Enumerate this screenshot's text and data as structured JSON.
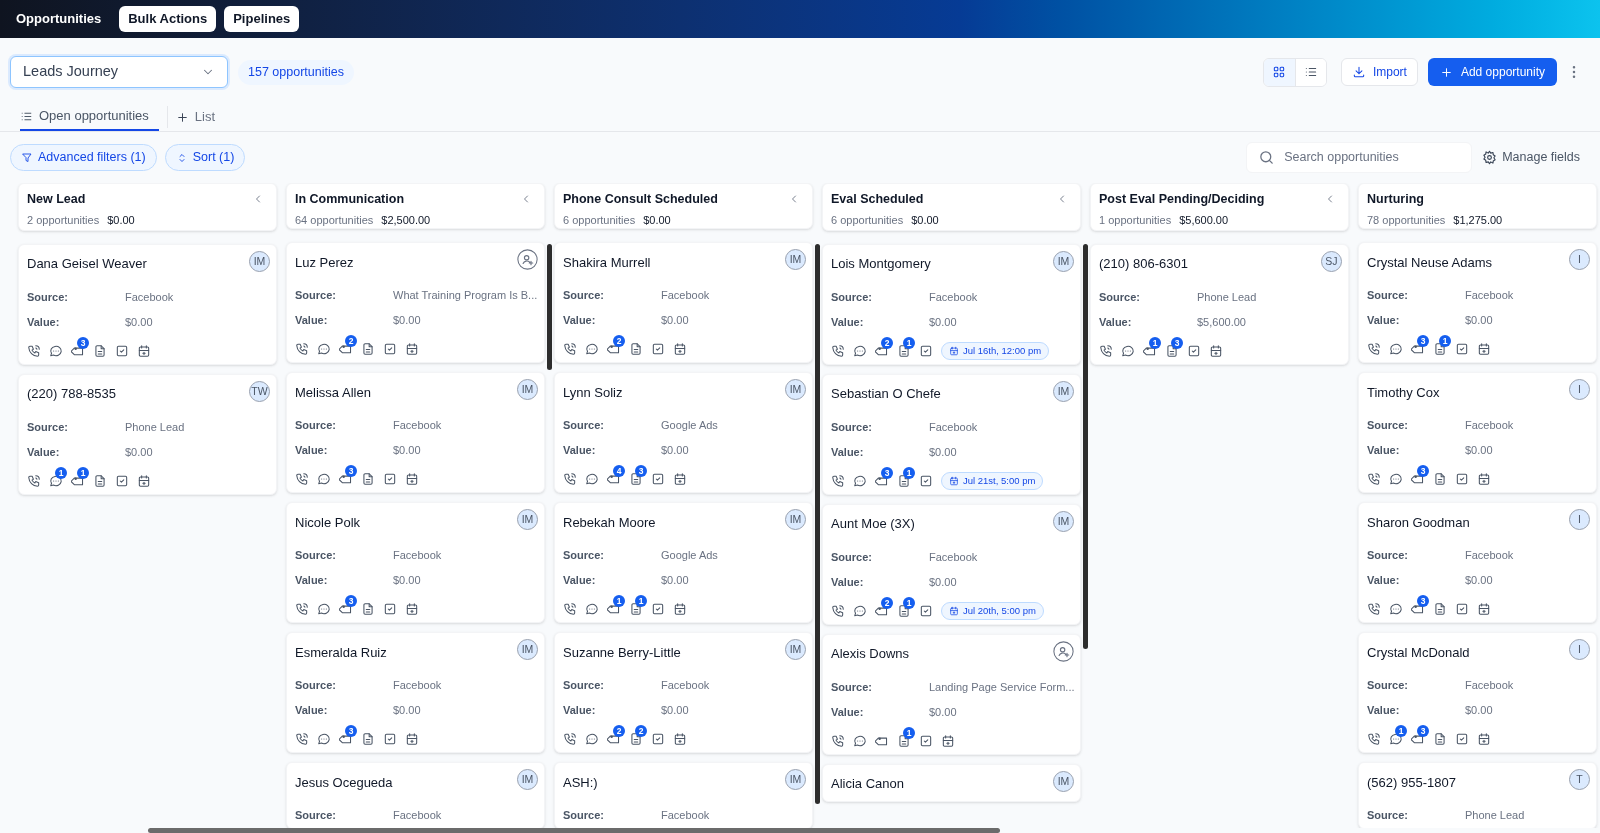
{
  "top_nav": [
    {
      "label": "Opportunities",
      "selected": true
    },
    {
      "label": "Bulk Actions",
      "selected": false
    },
    {
      "label": "Pipelines",
      "selected": false
    }
  ],
  "pipeline_select": {
    "value": "Leads Journey"
  },
  "opportunity_count": "157 opportunities",
  "view_toggle": [
    {
      "kind": "grid",
      "selected": true
    },
    {
      "kind": "list",
      "selected": false
    }
  ],
  "import_button": "Import",
  "add_button": "Add opportunity",
  "tabs": [
    {
      "label": "Open opportunities",
      "selected": true
    }
  ],
  "add_list_button": "List",
  "filters": [
    {
      "kind": "filter",
      "label": "Advanced filters (1)"
    },
    {
      "kind": "sort",
      "label": "Sort (1)"
    }
  ],
  "search": {
    "placeholder": "Search opportunities"
  },
  "manage_fields": "Manage fields",
  "columns": [
    {
      "title": "New Lead",
      "count": "2 opportunities",
      "amount": "$0.00",
      "collapsible": true,
      "cards": [
        {
          "name": "Dana Geisel Weaver",
          "assignee": "IM",
          "fields": [
            {
              "label": "Source:",
              "value": "Facebook"
            },
            {
              "label": "Value:",
              "value": "$0.00"
            }
          ],
          "actions": [
            {
              "kind": "call"
            },
            {
              "kind": "message"
            },
            {
              "kind": "tag",
              "count": "3"
            },
            {
              "kind": "note"
            },
            {
              "kind": "task"
            },
            {
              "kind": "calendar"
            }
          ]
        },
        {
          "name": "(220) 788-8535",
          "assignee": "TW",
          "fields": [
            {
              "label": "Source:",
              "value": "Phone Lead"
            },
            {
              "label": "Value:",
              "value": "$0.00"
            }
          ],
          "actions": [
            {
              "kind": "call"
            },
            {
              "kind": "message",
              "count": "1"
            },
            {
              "kind": "tag",
              "count": "1"
            },
            {
              "kind": "note"
            },
            {
              "kind": "task"
            },
            {
              "kind": "calendar"
            }
          ]
        }
      ]
    },
    {
      "title": "In Communication",
      "count": "64 opportunities",
      "amount": "$2,500.00",
      "collapsible": true,
      "cards": [
        {
          "name": "Luz Perez",
          "fields": [
            {
              "label": "Source:",
              "value": "What Training Program Is B..."
            },
            {
              "label": "Value:",
              "value": "$0.00"
            }
          ],
          "actions": [
            {
              "kind": "call"
            },
            {
              "kind": "message"
            },
            {
              "kind": "tag",
              "count": "2"
            },
            {
              "kind": "note"
            },
            {
              "kind": "task"
            },
            {
              "kind": "calendar"
            }
          ]
        },
        {
          "name": "Melissa Allen",
          "assignee": "IM",
          "fields": [
            {
              "label": "Source:",
              "value": "Facebook"
            },
            {
              "label": "Value:",
              "value": "$0.00"
            }
          ],
          "actions": [
            {
              "kind": "call"
            },
            {
              "kind": "message"
            },
            {
              "kind": "tag",
              "count": "3"
            },
            {
              "kind": "note"
            },
            {
              "kind": "task"
            },
            {
              "kind": "calendar"
            }
          ]
        },
        {
          "name": "Nicole Polk",
          "assignee": "IM",
          "fields": [
            {
              "label": "Source:",
              "value": "Facebook"
            },
            {
              "label": "Value:",
              "value": "$0.00"
            }
          ],
          "actions": [
            {
              "kind": "call"
            },
            {
              "kind": "message"
            },
            {
              "kind": "tag",
              "count": "3"
            },
            {
              "kind": "note"
            },
            {
              "kind": "task"
            },
            {
              "kind": "calendar"
            }
          ]
        },
        {
          "name": "Esmeralda Ruiz",
          "assignee": "IM",
          "fields": [
            {
              "label": "Source:",
              "value": "Facebook"
            },
            {
              "label": "Value:",
              "value": "$0.00"
            }
          ],
          "actions": [
            {
              "kind": "call"
            },
            {
              "kind": "message"
            },
            {
              "kind": "tag",
              "count": "3"
            },
            {
              "kind": "note"
            },
            {
              "kind": "task"
            },
            {
              "kind": "calendar"
            }
          ]
        },
        {
          "name": "Jesus Ocegueda",
          "assignee": "IM",
          "fields": [
            {
              "label": "Source:",
              "value": "Facebook"
            }
          ]
        }
      ]
    },
    {
      "title": "Phone Consult Scheduled",
      "count": "6 opportunities",
      "amount": "$0.00",
      "collapsible": true,
      "cards": [
        {
          "name": "Shakira Murrell",
          "assignee": "IM",
          "fields": [
            {
              "label": "Source:",
              "value": "Facebook"
            },
            {
              "label": "Value:",
              "value": "$0.00"
            }
          ],
          "actions": [
            {
              "kind": "call"
            },
            {
              "kind": "message"
            },
            {
              "kind": "tag",
              "count": "2"
            },
            {
              "kind": "note"
            },
            {
              "kind": "task"
            },
            {
              "kind": "calendar"
            }
          ]
        },
        {
          "name": "Lynn Soliz",
          "assignee": "IM",
          "fields": [
            {
              "label": "Source:",
              "value": "Google Ads"
            },
            {
              "label": "Value:",
              "value": "$0.00"
            }
          ],
          "actions": [
            {
              "kind": "call"
            },
            {
              "kind": "message"
            },
            {
              "kind": "tag",
              "count": "4"
            },
            {
              "kind": "note",
              "count": "3"
            },
            {
              "kind": "task"
            },
            {
              "kind": "calendar"
            }
          ]
        },
        {
          "name": "Rebekah Moore",
          "assignee": "IM",
          "fields": [
            {
              "label": "Source:",
              "value": "Google Ads"
            },
            {
              "label": "Value:",
              "value": "$0.00"
            }
          ],
          "actions": [
            {
              "kind": "call"
            },
            {
              "kind": "message"
            },
            {
              "kind": "tag",
              "count": "1"
            },
            {
              "kind": "note",
              "count": "1"
            },
            {
              "kind": "task"
            },
            {
              "kind": "calendar"
            }
          ]
        },
        {
          "name": "Suzanne Berry-Little",
          "assignee": "IM",
          "fields": [
            {
              "label": "Source:",
              "value": "Facebook"
            },
            {
              "label": "Value:",
              "value": "$0.00"
            }
          ],
          "actions": [
            {
              "kind": "call"
            },
            {
              "kind": "message"
            },
            {
              "kind": "tag",
              "count": "2"
            },
            {
              "kind": "note",
              "count": "2"
            },
            {
              "kind": "task"
            },
            {
              "kind": "calendar"
            }
          ]
        },
        {
          "name": "ASH:)",
          "assignee": "IM",
          "fields": [
            {
              "label": "Source:",
              "value": "Facebook"
            }
          ]
        }
      ]
    },
    {
      "title": "Eval Scheduled",
      "count": "6 opportunities",
      "amount": "$0.00",
      "collapsible": true,
      "cards": [
        {
          "name": "Lois Montgomery",
          "assignee": "IM",
          "fields": [
            {
              "label": "Source:",
              "value": "Facebook"
            },
            {
              "label": "Value:",
              "value": "$0.00"
            }
          ],
          "actions": [
            {
              "kind": "call"
            },
            {
              "kind": "message"
            },
            {
              "kind": "tag",
              "count": "2"
            },
            {
              "kind": "note",
              "count": "1"
            },
            {
              "kind": "task"
            },
            {
              "kind": "appointment",
              "label": "Jul 16th, 12:00 pm"
            }
          ]
        },
        {
          "name": "Sebastian O Chefe",
          "assignee": "IM",
          "fields": [
            {
              "label": "Source:",
              "value": "Facebook"
            },
            {
              "label": "Value:",
              "value": "$0.00"
            }
          ],
          "actions": [
            {
              "kind": "call"
            },
            {
              "kind": "message"
            },
            {
              "kind": "tag",
              "count": "3"
            },
            {
              "kind": "note",
              "count": "1"
            },
            {
              "kind": "task"
            },
            {
              "kind": "appointment",
              "label": "Jul 21st, 5:00 pm"
            }
          ]
        },
        {
          "name": "Aunt Moe (3X)",
          "assignee": "IM",
          "fields": [
            {
              "label": "Source:",
              "value": "Facebook"
            },
            {
              "label": "Value:",
              "value": "$0.00"
            }
          ],
          "actions": [
            {
              "kind": "call"
            },
            {
              "kind": "message"
            },
            {
              "kind": "tag",
              "count": "2"
            },
            {
              "kind": "note",
              "count": "1"
            },
            {
              "kind": "task"
            },
            {
              "kind": "appointment",
              "label": "Jul 20th, 5:00 pm"
            }
          ]
        },
        {
          "name": "Alexis Downs",
          "fields": [
            {
              "label": "Source:",
              "value": "Landing Page Service Form..."
            },
            {
              "label": "Value:",
              "value": "$0.00"
            }
          ],
          "actions": [
            {
              "kind": "call"
            },
            {
              "kind": "message"
            },
            {
              "kind": "tag"
            },
            {
              "kind": "note",
              "count": "1"
            },
            {
              "kind": "task"
            },
            {
              "kind": "calendar"
            }
          ]
        },
        {
          "name": "Alicia Canon",
          "assignee": "IM"
        }
      ]
    },
    {
      "title": "Post Eval Pending/Deciding",
      "count": "1 opportunities",
      "amount": "$5,600.00",
      "collapsible": true,
      "cards": [
        {
          "name": "(210) 806-6301",
          "assignee": "SJ",
          "fields": [
            {
              "label": "Source:",
              "value": "Phone Lead"
            },
            {
              "label": "Value:",
              "value": "$5,600.00"
            }
          ],
          "actions": [
            {
              "kind": "call"
            },
            {
              "kind": "message"
            },
            {
              "kind": "tag",
              "count": "1"
            },
            {
              "kind": "note",
              "count": "3"
            },
            {
              "kind": "task"
            },
            {
              "kind": "calendar"
            }
          ]
        }
      ]
    },
    {
      "title": "Nurturing",
      "count": "78 opportunities",
      "amount": "$1,275.00",
      "collapsible": false,
      "cards": [
        {
          "name": "Crystal Neuse Adams",
          "assignee": "I",
          "fields": [
            {
              "label": "Source:",
              "value": "Facebook"
            },
            {
              "label": "Value:",
              "value": "$0.00"
            }
          ],
          "actions": [
            {
              "kind": "call"
            },
            {
              "kind": "message"
            },
            {
              "kind": "tag",
              "count": "3"
            },
            {
              "kind": "note",
              "count": "1"
            },
            {
              "kind": "task"
            },
            {
              "kind": "calendar"
            }
          ]
        },
        {
          "name": "Timothy Cox",
          "assignee": "I",
          "fields": [
            {
              "label": "Source:",
              "value": "Facebook"
            },
            {
              "label": "Value:",
              "value": "$0.00"
            }
          ],
          "actions": [
            {
              "kind": "call"
            },
            {
              "kind": "message"
            },
            {
              "kind": "tag",
              "count": "3"
            },
            {
              "kind": "note"
            },
            {
              "kind": "task"
            },
            {
              "kind": "calendar"
            }
          ]
        },
        {
          "name": "Sharon Goodman",
          "assignee": "I",
          "fields": [
            {
              "label": "Source:",
              "value": "Facebook"
            },
            {
              "label": "Value:",
              "value": "$0.00"
            }
          ],
          "actions": [
            {
              "kind": "call"
            },
            {
              "kind": "message"
            },
            {
              "kind": "tag",
              "count": "3"
            },
            {
              "kind": "note"
            },
            {
              "kind": "task"
            },
            {
              "kind": "calendar"
            }
          ]
        },
        {
          "name": "Crystal McDonald",
          "assignee": "I",
          "fields": [
            {
              "label": "Source:",
              "value": "Facebook"
            },
            {
              "label": "Value:",
              "value": "$0.00"
            }
          ],
          "actions": [
            {
              "kind": "call"
            },
            {
              "kind": "message",
              "count": "1"
            },
            {
              "kind": "tag",
              "count": "3"
            },
            {
              "kind": "note"
            },
            {
              "kind": "task"
            },
            {
              "kind": "calendar"
            }
          ]
        },
        {
          "name": "(562) 955-1807",
          "assignee": "T",
          "fields": [
            {
              "label": "Source:",
              "value": "Phone Lead"
            }
          ]
        }
      ]
    }
  ]
}
